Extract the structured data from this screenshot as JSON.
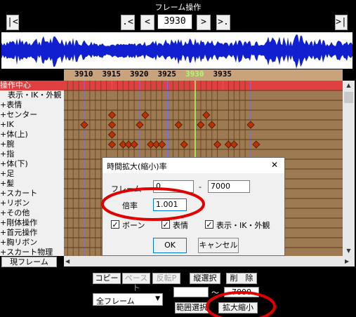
{
  "header": {
    "title": "フレーム操作",
    "first_btn": "|<",
    "prev_key_btn": ".<",
    "prev_btn": "<",
    "frame_value": "3930",
    "next_btn": ">",
    "next_key_btn": ">.",
    "last_btn": ">|"
  },
  "ruler": {
    "ticks": [
      {
        "label": "3910",
        "current": false
      },
      {
        "label": "3915",
        "current": false
      },
      {
        "label": "3920",
        "current": false
      },
      {
        "label": "3925",
        "current": false
      },
      {
        "label": "3930",
        "current": true
      },
      {
        "label": "3935",
        "current": false
      }
    ]
  },
  "rows": [
    {
      "label": "操作中心",
      "highlight": true
    },
    {
      "label": "　表示・IK・外観"
    },
    {
      "label": "+表情"
    },
    {
      "label": "+センター"
    },
    {
      "label": "+IK"
    },
    {
      "label": "+体(上)"
    },
    {
      "label": "+腕"
    },
    {
      "label": "+指"
    },
    {
      "label": "+体(下)"
    },
    {
      "label": "+足"
    },
    {
      "label": "+髪"
    },
    {
      "label": "+スカート"
    },
    {
      "label": "+リボン"
    },
    {
      "label": "+その他"
    },
    {
      "label": "+剛体操作"
    },
    {
      "label": "+首元操作"
    },
    {
      "label": "+胸リボン"
    },
    {
      "label": "+スカート物理"
    }
  ],
  "keyframes": [
    {
      "row": 3,
      "frames": [
        3915,
        3921,
        3932
      ]
    },
    {
      "row": 4,
      "frames": [
        3905,
        3910,
        3915,
        3920,
        3927,
        3931,
        3933,
        3940
      ]
    },
    {
      "row": 5,
      "frames": [
        3905,
        3915
      ]
    },
    {
      "row": 6,
      "frames": [
        3905,
        3915,
        3917,
        3918,
        3919,
        3922,
        3923,
        3924,
        3928,
        3934,
        3936,
        3937,
        3941
      ]
    }
  ],
  "footer": {
    "current_frame_btn": "現フレーム",
    "copy": "コピー",
    "paste": "ペースト",
    "reverse_paste": "反転P",
    "vertical_select": "縦選択",
    "delete": "削　除",
    "range_select_value": "全フレーム",
    "range_from": "",
    "range_sep": "～",
    "range_to": "7000",
    "range_select_btn": "範囲選択",
    "scale_btn": "拡大縮小"
  },
  "dialog": {
    "title": "時間拡大(縮小)率",
    "close": "✕",
    "frame_label": "フレーム",
    "frame_from": "0",
    "frame_sep": "-",
    "frame_to": "7000",
    "scale_label": "倍率",
    "scale_value": "1.001",
    "bone_label": "ボーン",
    "bone_checked": true,
    "face_label": "表情",
    "face_checked": true,
    "display_label": "表示・IK・外観",
    "display_checked": true,
    "ok": "OK",
    "cancel": "キャンセル"
  },
  "colors": {
    "background": "#000000",
    "ruler": "#c9a37b",
    "grid": "#9e7a52",
    "keyframe": "#c03000",
    "current_line": "#a8ff70",
    "annotation": "#e00000",
    "dialog_accent": "#0078d7"
  }
}
